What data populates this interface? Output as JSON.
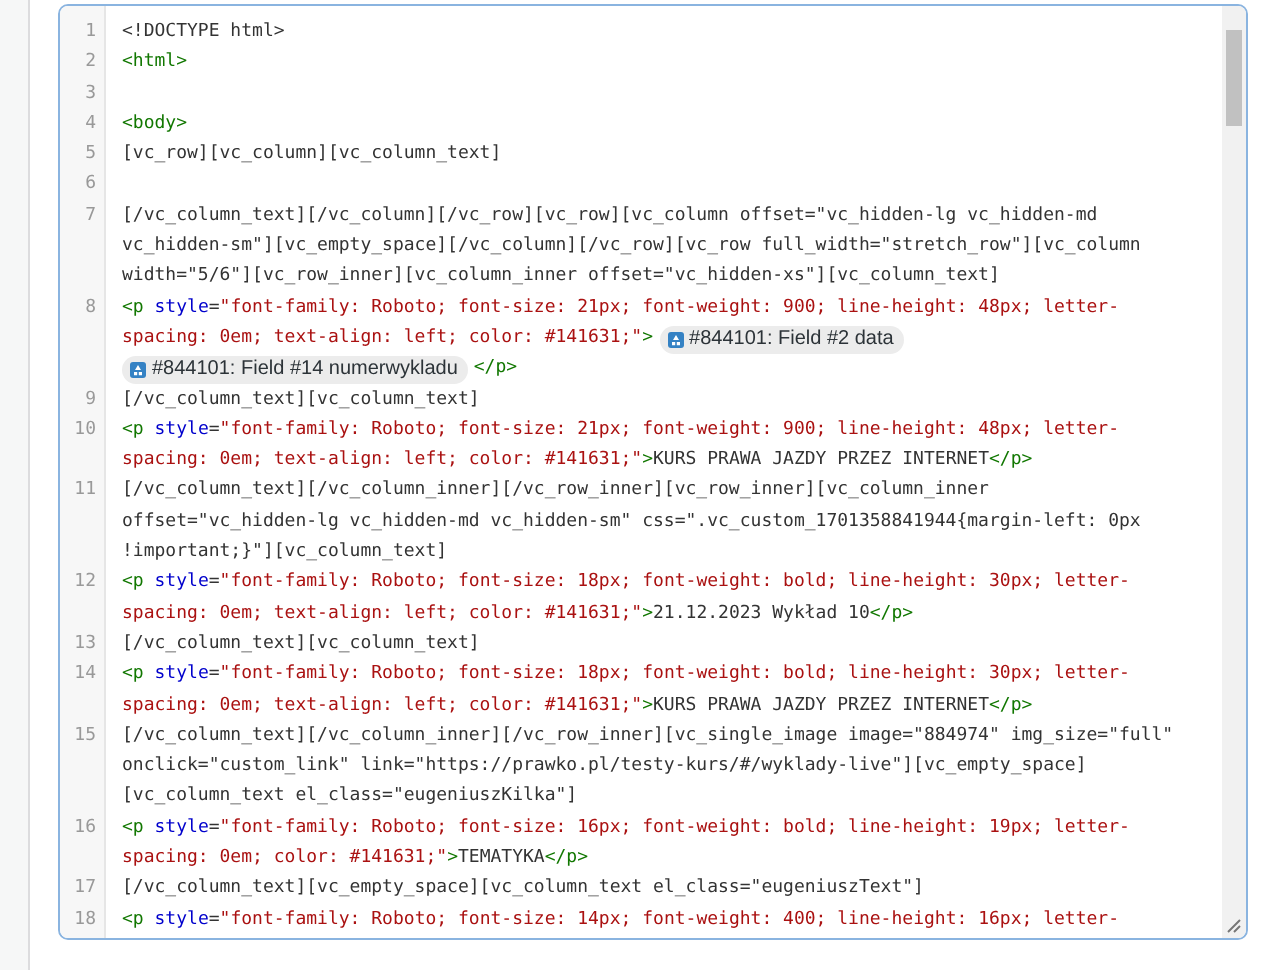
{
  "editor": {
    "lines": [
      {
        "number": "1",
        "rows": [
          {
            "tokens": [
              {
                "kind": "plain",
                "text": "<!DOCTYPE html>"
              }
            ]
          }
        ]
      },
      {
        "number": "2",
        "rows": [
          {
            "tokens": [
              {
                "kind": "tag",
                "text": "<html>"
              }
            ]
          }
        ]
      },
      {
        "number": "3",
        "rows": [
          {
            "tokens": []
          }
        ]
      },
      {
        "number": "4",
        "rows": [
          {
            "tokens": [
              {
                "kind": "tag",
                "text": "<body>"
              }
            ]
          }
        ]
      },
      {
        "number": "5",
        "rows": [
          {
            "tokens": [
              {
                "kind": "plain",
                "text": "[vc_row][vc_column][vc_column_text]"
              }
            ]
          }
        ]
      },
      {
        "number": "6",
        "rows": [
          {
            "tokens": []
          }
        ]
      },
      {
        "number": "7",
        "rows": [
          {
            "tokens": [
              {
                "kind": "plain",
                "text": "[/vc_column_text][/vc_column][/vc_row][vc_row][vc_column offset=\"vc_hidden-lg vc_hidden-md"
              }
            ]
          },
          {
            "tokens": [
              {
                "kind": "plain",
                "text": "vc_hidden-sm\"][vc_empty_space][/vc_column][/vc_row][vc_row full_width=\"stretch_row\"][vc_column"
              }
            ]
          },
          {
            "tokens": [
              {
                "kind": "plain",
                "text": "width=\"5/6\"][vc_row_inner][vc_column_inner offset=\"vc_hidden-xs\"][vc_column_text]"
              }
            ]
          }
        ]
      },
      {
        "number": "8",
        "rows": [
          {
            "tokens": [
              {
                "kind": "tag",
                "text": "<p "
              },
              {
                "kind": "attr",
                "text": "style"
              },
              {
                "kind": "plain",
                "text": "="
              },
              {
                "kind": "value",
                "text": "\"font-family: Roboto; font-size: 21px; font-weight: 900; line-height: 48px; letter-"
              }
            ]
          },
          {
            "tokens": [
              {
                "kind": "value",
                "text": "spacing: 0em; text-align: left; color: #141631;\""
              },
              {
                "kind": "tag",
                "text": ">"
              },
              {
                "kind": "chip",
                "text": "#844101: Field #2 data"
              }
            ]
          },
          {
            "tokens": [
              {
                "kind": "chip",
                "text": "#844101: Field #14 numerwykladu"
              },
              {
                "kind": "tag",
                "text": "</p>"
              }
            ]
          }
        ]
      },
      {
        "number": "9",
        "rows": [
          {
            "tokens": [
              {
                "kind": "plain",
                "text": "[/vc_column_text][vc_column_text]"
              }
            ]
          }
        ]
      },
      {
        "number": "10",
        "rows": [
          {
            "tokens": [
              {
                "kind": "tag",
                "text": "<p "
              },
              {
                "kind": "attr",
                "text": "style"
              },
              {
                "kind": "plain",
                "text": "="
              },
              {
                "kind": "value",
                "text": "\"font-family: Roboto; font-size: 21px; font-weight: 900; line-height: 48px; letter-"
              }
            ]
          },
          {
            "tokens": [
              {
                "kind": "value",
                "text": "spacing: 0em; text-align: left; color: #141631;\""
              },
              {
                "kind": "tag",
                "text": ">"
              },
              {
                "kind": "plain",
                "text": "KURS PRAWA JAZDY PRZEZ INTERNET"
              },
              {
                "kind": "tag",
                "text": "</p>"
              }
            ]
          }
        ]
      },
      {
        "number": "11",
        "rows": [
          {
            "tokens": [
              {
                "kind": "plain",
                "text": "[/vc_column_text][/vc_column_inner][/vc_row_inner][vc_row_inner][vc_column_inner"
              }
            ]
          },
          {
            "tokens": [
              {
                "kind": "plain",
                "text": "offset=\"vc_hidden-lg vc_hidden-md vc_hidden-sm\" css=\".vc_custom_1701358841944{margin-left: 0px"
              }
            ]
          },
          {
            "tokens": [
              {
                "kind": "plain",
                "text": "!important;}\"][vc_column_text]"
              }
            ]
          }
        ]
      },
      {
        "number": "12",
        "rows": [
          {
            "tokens": [
              {
                "kind": "tag",
                "text": "<p "
              },
              {
                "kind": "attr",
                "text": "style"
              },
              {
                "kind": "plain",
                "text": "="
              },
              {
                "kind": "value",
                "text": "\"font-family: Roboto; font-size: 18px; font-weight: bold; line-height: 30px; letter-"
              }
            ]
          },
          {
            "tokens": [
              {
                "kind": "value",
                "text": "spacing: 0em; text-align: left; color: #141631;\""
              },
              {
                "kind": "tag",
                "text": ">"
              },
              {
                "kind": "plain",
                "text": "21.12.2023 Wykład 10"
              },
              {
                "kind": "tag",
                "text": "</p>"
              }
            ]
          }
        ]
      },
      {
        "number": "13",
        "rows": [
          {
            "tokens": [
              {
                "kind": "plain",
                "text": "[/vc_column_text][vc_column_text]"
              }
            ]
          }
        ]
      },
      {
        "number": "14",
        "rows": [
          {
            "tokens": [
              {
                "kind": "tag",
                "text": "<p "
              },
              {
                "kind": "attr",
                "text": "style"
              },
              {
                "kind": "plain",
                "text": "="
              },
              {
                "kind": "value",
                "text": "\"font-family: Roboto; font-size: 18px; font-weight: bold; line-height: 30px; letter-"
              }
            ]
          },
          {
            "tokens": [
              {
                "kind": "value",
                "text": "spacing: 0em; text-align: left; color: #141631;\""
              },
              {
                "kind": "tag",
                "text": ">"
              },
              {
                "kind": "plain",
                "text": "KURS PRAWA JAZDY PRZEZ INTERNET"
              },
              {
                "kind": "tag",
                "text": "</p>"
              }
            ]
          }
        ]
      },
      {
        "number": "15",
        "rows": [
          {
            "tokens": [
              {
                "kind": "plain",
                "text": "[/vc_column_text][/vc_column_inner][/vc_row_inner][vc_single_image image=\"884974\" img_size=\"full\""
              }
            ]
          },
          {
            "tokens": [
              {
                "kind": "plain",
                "text": "onclick=\"custom_link\" link=\"https://prawko.pl/testy-kurs/#/wyklady-live\"][vc_empty_space]"
              }
            ]
          },
          {
            "tokens": [
              {
                "kind": "plain",
                "text": "[vc_column_text el_class=\"eugeniuszKilka\"]"
              }
            ]
          }
        ]
      },
      {
        "number": "16",
        "rows": [
          {
            "tokens": [
              {
                "kind": "tag",
                "text": "<p "
              },
              {
                "kind": "attr",
                "text": "style"
              },
              {
                "kind": "plain",
                "text": "="
              },
              {
                "kind": "value",
                "text": "\"font-family: Roboto; font-size: 16px; font-weight: bold; line-height: 19px; letter-"
              }
            ]
          },
          {
            "tokens": [
              {
                "kind": "value",
                "text": "spacing: 0em; color: #141631;\""
              },
              {
                "kind": "tag",
                "text": ">"
              },
              {
                "kind": "plain",
                "text": "TEMATYKA"
              },
              {
                "kind": "tag",
                "text": "</p>"
              }
            ]
          }
        ]
      },
      {
        "number": "17",
        "rows": [
          {
            "tokens": [
              {
                "kind": "plain",
                "text": "[/vc_column_text][vc_empty_space][vc_column_text el_class=\"eugeniuszText\"]"
              }
            ]
          }
        ]
      },
      {
        "number": "18",
        "rows": [
          {
            "tokens": [
              {
                "kind": "tag",
                "text": "<p "
              },
              {
                "kind": "attr",
                "text": "style"
              },
              {
                "kind": "plain",
                "text": "="
              },
              {
                "kind": "value",
                "text": "\"font-family: Roboto; font-size: 14px; font-weight: 400; line-height: 16px; letter-"
              }
            ]
          }
        ]
      }
    ]
  }
}
